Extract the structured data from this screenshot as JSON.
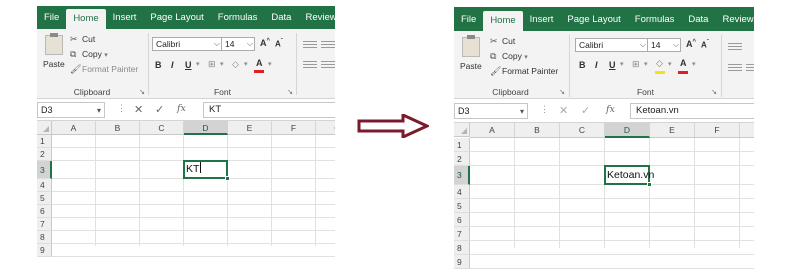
{
  "ribbon": {
    "tabs": [
      "File",
      "Home",
      "Insert",
      "Page Layout",
      "Formulas",
      "Data",
      "Review"
    ],
    "active_tab": "Home",
    "accent_color": "#217346"
  },
  "clipboard": {
    "paste": "Paste",
    "cut": "Cut",
    "copy": "Copy",
    "format_painter": "Format Painter",
    "group_label": "Clipboard"
  },
  "font": {
    "name": "Calibri",
    "size": "14",
    "grow": "A",
    "shrink": "A",
    "bold": "B",
    "italic": "I",
    "underline": "U",
    "font_color": "A",
    "group_label": "Font"
  },
  "grid": {
    "columns": [
      "A",
      "B",
      "C",
      "D",
      "E",
      "F",
      "G"
    ],
    "rows": [
      "1",
      "2",
      "3",
      "4",
      "5",
      "6",
      "7",
      "8",
      "9"
    ],
    "selected_column": "D",
    "selected_row": "3"
  },
  "panels": {
    "before": {
      "name_box": "D3",
      "fx": "fx",
      "formula": "KT",
      "cell_value": "KT",
      "mode": "editing"
    },
    "after": {
      "name_box": "D3",
      "fx": "fx",
      "formula": "Ketoan.vn",
      "cell_value": "Ketoan.vn",
      "mode": "entered"
    }
  },
  "arrow_color": "#7a1b2c"
}
